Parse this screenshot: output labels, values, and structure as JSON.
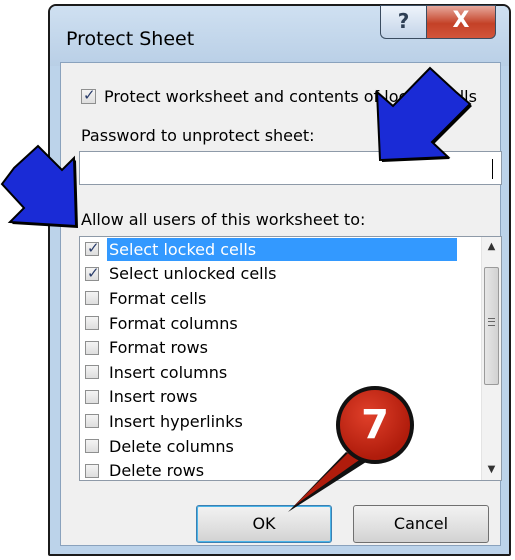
{
  "dialog": {
    "title": "Protect Sheet",
    "help_glyph": "?",
    "close_glyph": "X",
    "protect_checkbox": {
      "label": "Protect worksheet and contents of locked cells",
      "checked": true
    },
    "password": {
      "label": "Password to unprotect sheet:",
      "value": ""
    },
    "allow_label": "Allow all users of this worksheet to:",
    "permissions": [
      {
        "label": "Select locked cells",
        "checked": true,
        "selected": true
      },
      {
        "label": "Select unlocked cells",
        "checked": true,
        "selected": false
      },
      {
        "label": "Format cells",
        "checked": false,
        "selected": false
      },
      {
        "label": "Format columns",
        "checked": false,
        "selected": false
      },
      {
        "label": "Format rows",
        "checked": false,
        "selected": false
      },
      {
        "label": "Insert columns",
        "checked": false,
        "selected": false
      },
      {
        "label": "Insert rows",
        "checked": false,
        "selected": false
      },
      {
        "label": "Insert hyperlinks",
        "checked": false,
        "selected": false
      },
      {
        "label": "Delete columns",
        "checked": false,
        "selected": false
      },
      {
        "label": "Delete rows",
        "checked": false,
        "selected": false
      }
    ],
    "ok_label": "OK",
    "cancel_label": "Cancel"
  },
  "annotations": {
    "step_badge": "7",
    "arrow_color": "#1a2bd6",
    "badge_color": "#c0200e"
  },
  "colors": {
    "selection": "#3399ff",
    "frame": "#bcd3ea"
  }
}
